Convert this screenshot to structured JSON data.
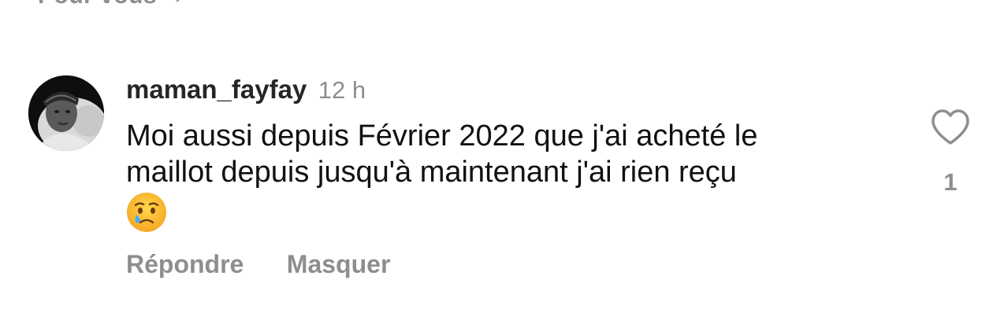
{
  "top_partial": {
    "label": "Pour vous",
    "chevron": "chevron-right-icon"
  },
  "comment": {
    "username": "maman_fayfay",
    "timestamp": "12 h",
    "text_line_1": "Moi aussi depuis Février 2022 que j'ai acheté le",
    "text_line_2": "maillot depuis jusqu'à maintenant j'ai rien reçu",
    "emoji": "crying-face-emoji",
    "like_icon": "heart-outline-icon",
    "like_count": "1",
    "actions": {
      "reply_label": "Répondre",
      "hide_label": "Masquer"
    }
  },
  "colors": {
    "username": "#262626",
    "muted": "#8e8e8e",
    "text": "#111111",
    "background": "#ffffff"
  }
}
